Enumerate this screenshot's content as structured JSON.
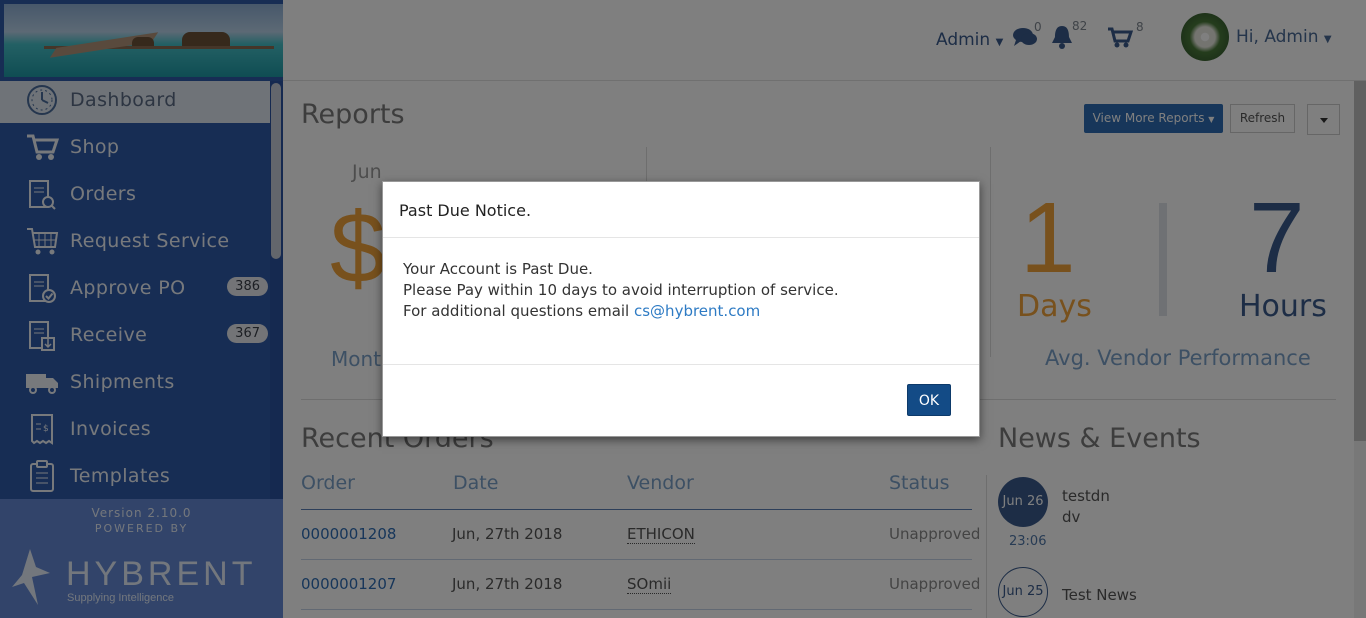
{
  "sidebar": {
    "items": [
      {
        "label": "Dashboard",
        "icon": "dashboard-clock-icon"
      },
      {
        "label": "Shop",
        "icon": "cart-icon"
      },
      {
        "label": "Orders",
        "icon": "order-search-icon"
      },
      {
        "label": "Request Service",
        "icon": "request-service-icon"
      },
      {
        "label": "Approve PO",
        "icon": "approve-doc-icon",
        "badge": "386"
      },
      {
        "label": "Receive",
        "icon": "receive-doc-icon",
        "badge": "367"
      },
      {
        "label": "Shipments",
        "icon": "truck-icon"
      },
      {
        "label": "Invoices",
        "icon": "invoice-icon"
      },
      {
        "label": "Templates",
        "icon": "template-icon"
      }
    ],
    "version": "Version 2.10.0",
    "powered_by": "POWERED BY",
    "brand_name": "HYBRENT",
    "brand_tagline": "Supplying Intelligence"
  },
  "header": {
    "admin_menu": "Admin",
    "messages_count": "0",
    "notifications_count": "82",
    "cart_count": "8",
    "greeting": "Hi, Admin"
  },
  "reports": {
    "title": "Reports",
    "view_more": "View More Reports",
    "refresh": "Refresh",
    "stat_month": "Jun",
    "stat_currency": "$",
    "stat_label": "Mont",
    "days_value": "1",
    "days_unit": "Days",
    "hours_value": "7",
    "hours_unit": "Hours",
    "vendor_perf_label": "Avg. Vendor Performance"
  },
  "orders": {
    "title": "Recent Orders",
    "columns": [
      "Order",
      "Date",
      "Vendor",
      "Status"
    ],
    "rows": [
      {
        "order": "0000001208",
        "date": "Jun, 27th 2018",
        "vendor": "ETHICON",
        "status": "Unapproved"
      },
      {
        "order": "0000001207",
        "date": "Jun, 27th 2018",
        "vendor": "SOmii",
        "status": "Unapproved"
      }
    ]
  },
  "news": {
    "title": "News & Events",
    "items": [
      {
        "date": "Jun 26",
        "time": "23:06",
        "title": "testdn",
        "sub": "dv"
      },
      {
        "date": "Jun 25",
        "title": "Test News"
      }
    ]
  },
  "modal": {
    "title": "Past Due Notice.",
    "line1": "Your Account is Past Due.",
    "line2": "Please Pay within 10 days to avoid interruption of service.",
    "line3": "For additional questions email ",
    "email": "cs@hybrent.com",
    "ok": "OK"
  },
  "colors": {
    "accent": "#2e6db4",
    "sidebar": "#2f5ba8",
    "orange": "#f0a23a",
    "ok_button": "#134b86"
  }
}
